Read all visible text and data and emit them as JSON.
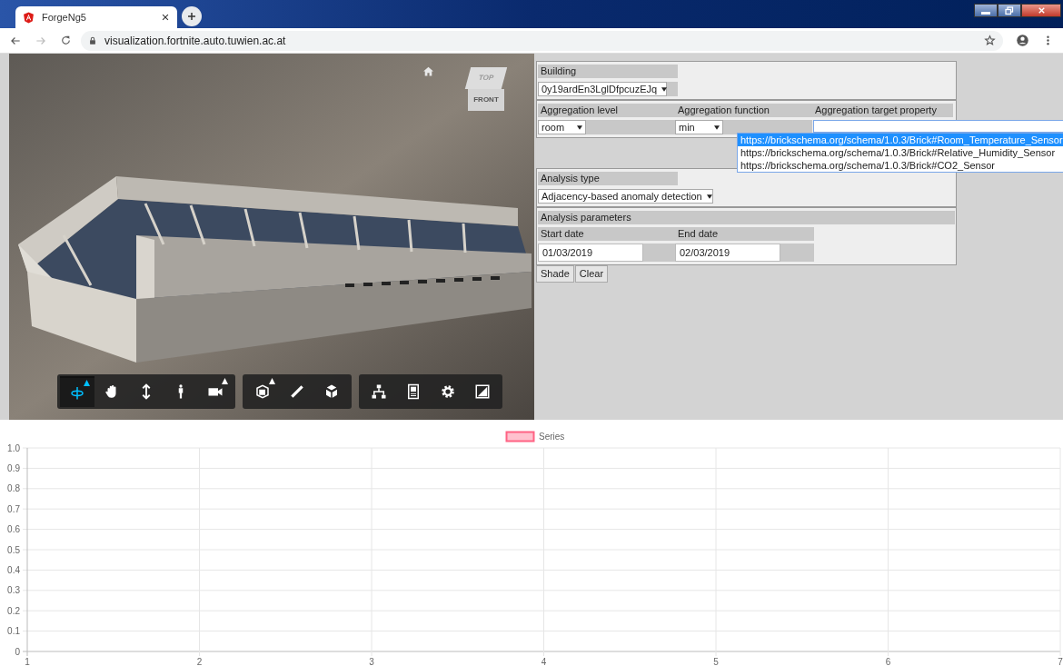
{
  "browser": {
    "tab_title": "ForgeNg5",
    "url": "visualization.fortnite.auto.tuwien.ac.at"
  },
  "viewer": {
    "viewcube_top": "TOP",
    "viewcube_front": "FRONT",
    "toolbar": [
      [
        {
          "kind": "orbit",
          "selected": true,
          "flyout": true
        },
        {
          "kind": "pan",
          "selected": false,
          "flyout": false
        },
        {
          "kind": "zoom",
          "selected": false,
          "flyout": false
        },
        {
          "kind": "walk",
          "selected": false,
          "flyout": false
        },
        {
          "kind": "camera",
          "selected": false,
          "flyout": true
        }
      ],
      [
        {
          "kind": "section",
          "selected": false,
          "flyout": true
        },
        {
          "kind": "measure",
          "selected": false,
          "flyout": false
        },
        {
          "kind": "explode",
          "selected": false,
          "flyout": false
        }
      ],
      [
        {
          "kind": "tree",
          "selected": false,
          "flyout": false
        },
        {
          "kind": "properties",
          "selected": false,
          "flyout": false
        },
        {
          "kind": "settings",
          "selected": false,
          "flyout": false
        },
        {
          "kind": "fullscreen",
          "selected": false,
          "flyout": false
        }
      ]
    ]
  },
  "form": {
    "building": {
      "label": "Building",
      "value": "0y19ardEn3LglDfpcuzEJq"
    },
    "aggregation": {
      "level_label": "Aggregation level",
      "level_value": "room",
      "function_label": "Aggregation function",
      "function_value": "min",
      "target_label": "Aggregation target property"
    },
    "target_options": [
      {
        "text": "https://brickschema.org/schema/1.0.3/Brick#Room_Temperature_Sensor",
        "selected": true
      },
      {
        "text": "https://brickschema.org/schema/1.0.3/Brick#Relative_Humidity_Sensor",
        "selected": false
      },
      {
        "text": "https://brickschema.org/schema/1.0.3/Brick#CO2_Sensor",
        "selected": false
      }
    ],
    "analysis_type": {
      "label": "Analysis type",
      "value": "Adjacency-based anomaly detection"
    },
    "parameters": {
      "label": "Analysis parameters",
      "start_label": "Start date",
      "start_value": "01/03/2019",
      "end_label": "End date",
      "end_value": "02/03/2019"
    },
    "buttons": [
      "Shade",
      "Clear"
    ]
  },
  "chart": {
    "chart_data": {
      "type": "line",
      "grid": true,
      "categories": [
        "1",
        "2",
        "3",
        "4",
        "5",
        "6",
        "7"
      ],
      "series": [
        {
          "name": "Series",
          "color": "#ff6384",
          "values": [
            null,
            null,
            null,
            null,
            null,
            null,
            null
          ]
        }
      ],
      "ylim": [
        0,
        1
      ],
      "yticks": [
        0,
        0.1,
        0.2,
        0.3,
        0.4,
        0.5,
        0.6,
        0.7,
        0.8,
        0.9,
        {
          "value": 1,
          "label": "1.0"
        }
      ]
    }
  }
}
